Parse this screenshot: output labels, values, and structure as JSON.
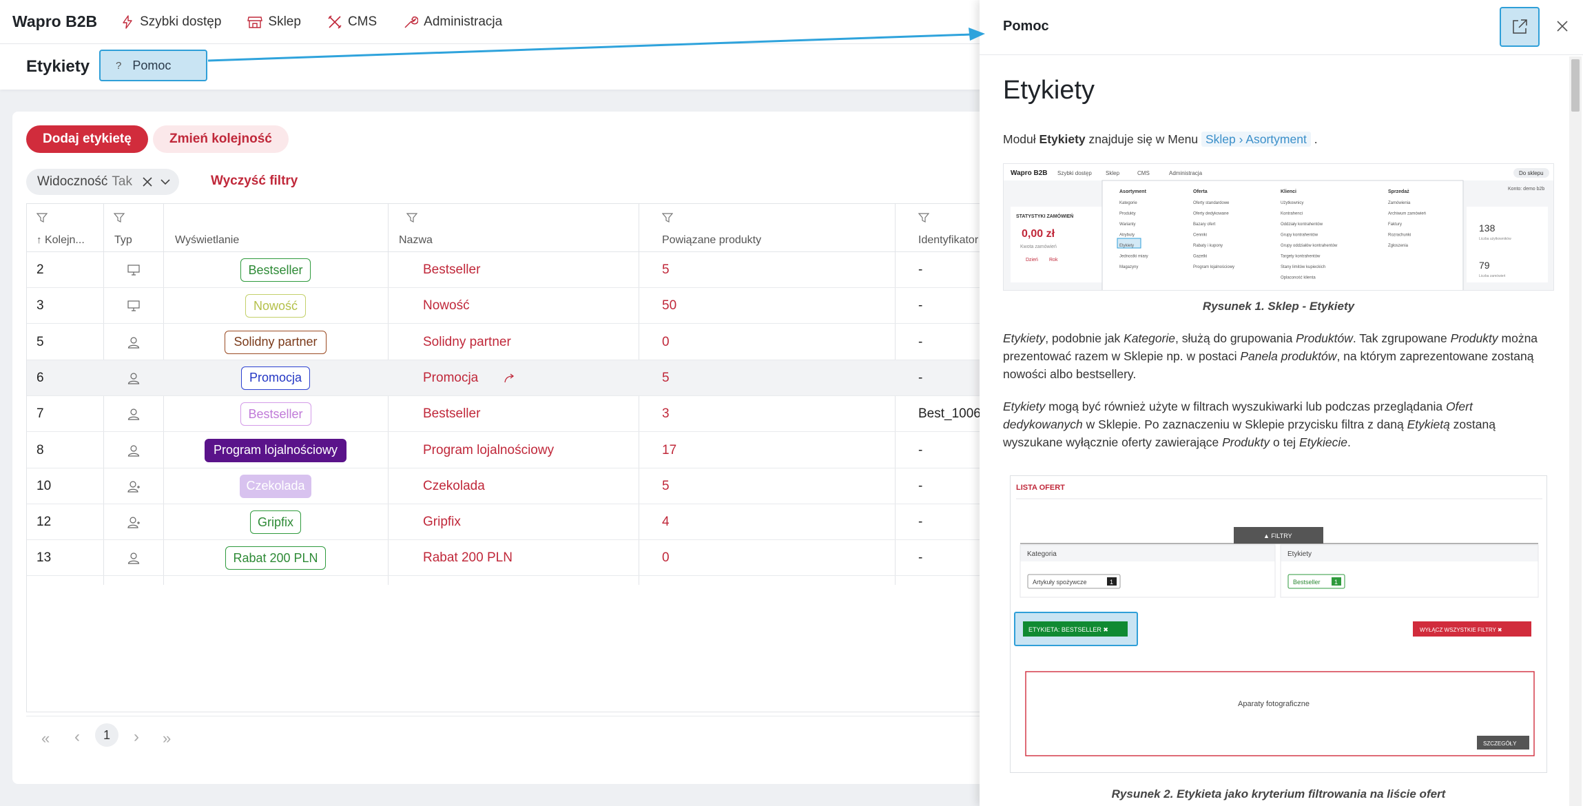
{
  "nav": {
    "brand": "Wapro B2B",
    "items": [
      {
        "label": "Szybki dostęp",
        "icon": "lightning-icon"
      },
      {
        "label": "Sklep",
        "icon": "shop-icon"
      },
      {
        "label": "CMS",
        "icon": "tools-icon"
      },
      {
        "label": "Administracja",
        "icon": "wrench-icon"
      }
    ]
  },
  "header": {
    "title": "Etykiety",
    "help_label": "Pomoc",
    "help_icon_glyph": "?"
  },
  "toolbar": {
    "add_label": "Dodaj etykietę",
    "reorder_label": "Zmień kolejność"
  },
  "filter": {
    "chip_name": "Widoczność",
    "chip_value": "Tak",
    "clear_label": "Wyczyść filtry"
  },
  "table": {
    "columns": [
      "Kolejn...",
      "Typ",
      "Wyświetlanie",
      "Nazwa",
      "Powiązane produkty",
      "Identyfikator ze"
    ],
    "rows": [
      {
        "order": "2",
        "type": "monitor",
        "badge": "Bestseller",
        "badge_style": "outline-green",
        "name": "Bestseller",
        "count": "5",
        "ident": "-"
      },
      {
        "order": "3",
        "type": "monitor",
        "badge": "Nowość",
        "badge_style": "outline-lime",
        "name": "Nowość",
        "count": "50",
        "ident": "-"
      },
      {
        "order": "5",
        "type": "user",
        "badge": "Solidny partner",
        "badge_style": "outline-brown",
        "name": "Solidny partner",
        "count": "0",
        "ident": "-"
      },
      {
        "order": "6",
        "type": "user",
        "badge": "Promocja",
        "badge_style": "outline-blue",
        "name": "Promocja",
        "count": "5",
        "ident": "-"
      },
      {
        "order": "7",
        "type": "user",
        "badge": "Bestseller",
        "badge_style": "outline-violet",
        "name": "Bestseller",
        "count": "3",
        "ident": "Best_1006"
      },
      {
        "order": "8",
        "type": "user",
        "badge": "Program lojalnościowy",
        "badge_style": "solid-purple",
        "name": "Program lojalnościowy",
        "count": "17",
        "ident": "-"
      },
      {
        "order": "10",
        "type": "users",
        "badge": "Czekolada",
        "badge_style": "solid-lavender",
        "name": "Czekolada",
        "count": "5",
        "ident": "-"
      },
      {
        "order": "12",
        "type": "users",
        "badge": "Gripfix",
        "badge_style": "outline-green",
        "name": "Gripfix",
        "count": "4",
        "ident": "-"
      },
      {
        "order": "13",
        "type": "user",
        "badge": "Rabat 200 PLN",
        "badge_style": "outline-green",
        "name": "Rabat 200 PLN",
        "count": "0",
        "ident": "-"
      }
    ]
  },
  "pagination": {
    "current": "1",
    "first": "«",
    "prev": "‹",
    "next": "›",
    "last": "»"
  },
  "panel": {
    "title": "Pomoc",
    "heading": "Etykiety",
    "intro_pre": "Moduł ",
    "intro_bold": "Etykiety",
    "intro_post": " znajduje się w Menu ",
    "crumb_a": "Sklep",
    "crumb_sep": " › ",
    "crumb_b": "Asortyment",
    "intro_end": " .",
    "caption1": "Rysunek 1. Sklep - Etykiety",
    "para1": [
      {
        "t": "Etykiety",
        "i": true
      },
      {
        "t": ", podobnie jak "
      },
      {
        "t": "Kategorie",
        "i": true
      },
      {
        "t": ", służą do grupowania "
      },
      {
        "t": "Produktów",
        "i": true
      },
      {
        "t": ". Tak zgrupowane "
      },
      {
        "t": "Produkty",
        "i": true
      },
      {
        "t": " można prezentować razem w Sklepie np. w postaci "
      },
      {
        "t": "Panela produktów",
        "i": true
      },
      {
        "t": ", na którym zaprezentowane zostaną nowości albo bestsellery."
      }
    ],
    "para2": [
      {
        "t": "Etykiety",
        "i": true
      },
      {
        "t": " mogą być również użyte w filtrach wyszukiwarki lub podczas przeglądania "
      },
      {
        "t": "Ofert dedykowanych",
        "i": true
      },
      {
        "t": " w Sklepie. Po zaznaczeniu w Sklepie przycisku filtra z daną "
      },
      {
        "t": "Etykietą",
        "i": true
      },
      {
        "t": " zostaną wyszukane wyłącznie oferty zawierające "
      },
      {
        "t": "Produkty",
        "i": true
      },
      {
        "t": " o tej "
      },
      {
        "t": "Etykiecie",
        "i": true
      },
      {
        "t": "."
      }
    ],
    "caption2": "Rysunek 2. Etykieta jako kryterium filtrowania na liście ofert",
    "shot1": {
      "brand": "Wapro B2B",
      "nav": [
        "Szybki dostęp",
        "Sklep",
        "CMS",
        "Administracja"
      ],
      "shop_btn": "Do sklepu",
      "konto": "Konto: demo b2b",
      "stat_title": "STATYSTYKI ZAMÓWIEŃ",
      "amount": "0,00 zł",
      "amount_label": "Kwota zamówień",
      "tabs": [
        "Dzień",
        "Rok"
      ],
      "right_num1": "138",
      "right_lbl1": "Liczba użytkowników",
      "right_num2": "79",
      "right_lbl2": "Liczba zamówień",
      "menu": [
        {
          "head": "Asortyment",
          "items": [
            "Kategorie",
            "Produkty",
            "Warianty",
            "Atrybuty",
            "Etykiety",
            "Jednostki miary",
            "Magazyny"
          ]
        },
        {
          "head": "Oferta",
          "items": [
            "Oferty standardowe",
            "Oferty dedykowane",
            "Bazary ofert",
            "Cenniki",
            "Rabaty i kupony",
            "Gazetki",
            "Program lojalnościowy"
          ]
        },
        {
          "head": "Klienci",
          "items": [
            "Użytkownicy",
            "Kontrahenci",
            "Oddziały kontrahentów",
            "Grupy kontrahentów",
            "Grupy oddziałów kontrahentów",
            "Targety kontrahentów",
            "Stany limitów kupieckich",
            "Oplaconość klienta"
          ]
        },
        {
          "head": "Sprzedaż",
          "items": [
            "Zamówienia",
            "Archiwum zamówień",
            "Faktury",
            "Rozrachunki",
            "Zgłoszenia"
          ]
        }
      ]
    },
    "shot2": {
      "title": "LISTA OFERT",
      "filters_tab": "FILTRY",
      "col1": "Kategoria",
      "col2": "Etykiety",
      "chip1": "Artykuły spożywcze",
      "chip1_count": "1",
      "chip2": "Bestseller",
      "chip2_count": "1",
      "active": "ETYKIETA:  BESTSELLER",
      "disable_all": "WYŁĄCZ WSZYSTKIE FILTRY",
      "product": "Aparaty fotograficzne",
      "details": "SZCZEGÓŁY"
    }
  },
  "colors": {
    "accent_red": "#d12c3c",
    "link_red": "#c0283a",
    "highlight_blue": "#2f9fd8"
  }
}
